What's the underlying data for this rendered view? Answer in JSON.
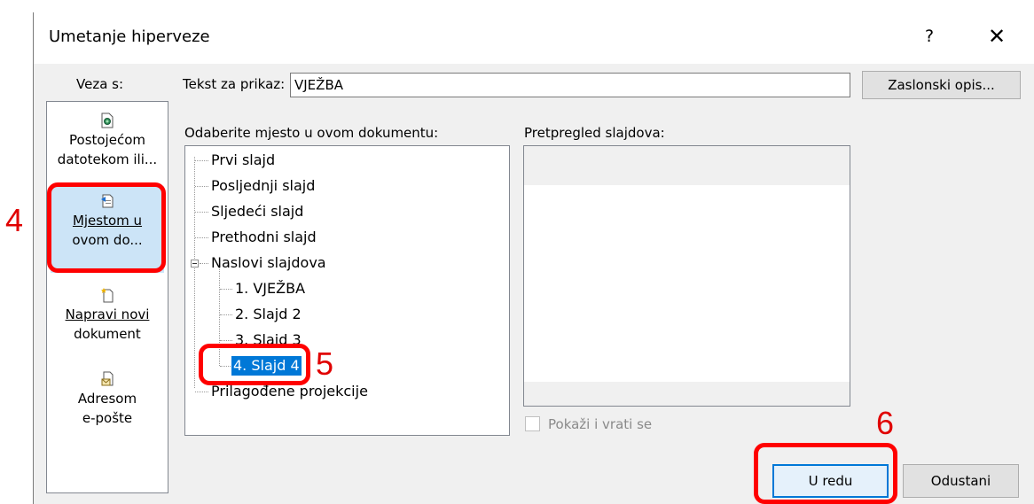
{
  "dialog": {
    "title": "Umetanje hiperveze",
    "help_label": "?",
    "close_label": "✕"
  },
  "link_with": {
    "label": "Veza s:",
    "items": [
      {
        "line1": "Postojećom",
        "line2": "datotekom ili...",
        "icon": "existing-file-icon",
        "selected": false
      },
      {
        "line1": "Mjestom u",
        "line2": "ovom do...",
        "icon": "place-in-document-icon",
        "selected": true
      },
      {
        "line1": "Napravi novi",
        "line2": "dokument",
        "icon": "new-document-icon",
        "selected": false
      },
      {
        "line1": "Adresom",
        "line2": "e-pošte",
        "icon": "email-address-icon",
        "selected": false
      }
    ]
  },
  "text_to_display": {
    "label": "Tekst za prikaz:",
    "value": "VJEŽBA"
  },
  "screentip_button": "Zaslonski opis...",
  "place_in_document": {
    "label": "Odaberite mjesto u ovom dokumentu:",
    "tree": [
      {
        "label": "Prvi slajd",
        "level": 0
      },
      {
        "label": "Posljednji slajd",
        "level": 0
      },
      {
        "label": "Sljedeći slajd",
        "level": 0
      },
      {
        "label": "Prethodni slajd",
        "level": 0
      },
      {
        "label": "Naslovi slajdova",
        "level": 0,
        "expanded": true
      },
      {
        "label": "1. VJEŽBA",
        "level": 1
      },
      {
        "label": "2. Slajd 2",
        "level": 1
      },
      {
        "label": "3. Slajd 3",
        "level": 1
      },
      {
        "label": "4. Slajd 4",
        "level": 1,
        "selected": true
      },
      {
        "label": "Prilagođene projekcije",
        "level": 0
      }
    ]
  },
  "slide_preview": {
    "label": "Pretpregled slajdova:",
    "checkbox_label": "Pokaži i vrati se",
    "checked": false
  },
  "buttons": {
    "ok": "U redu",
    "cancel": "Odustani"
  },
  "annotations": {
    "step4": "4",
    "step5": "5",
    "step6": "6",
    "color": "#ff0000"
  },
  "colors": {
    "selection": "#0078d7",
    "nav_selected": "#cce4f7"
  }
}
